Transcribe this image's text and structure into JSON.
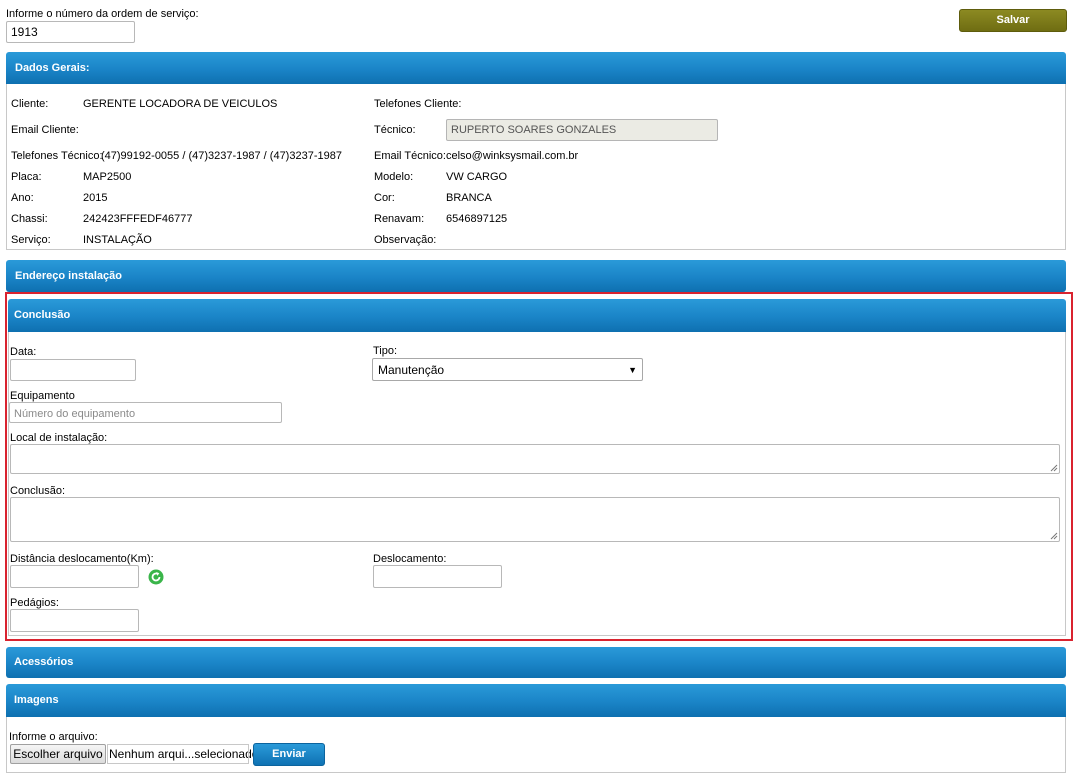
{
  "top": {
    "order_label": "Informe o número da ordem de serviço:",
    "order_value": "1913",
    "save_label": "Salvar"
  },
  "dados_gerais": {
    "title": "Dados Gerais:",
    "cliente_label": "Cliente:",
    "cliente_value": "GERENTE LOCADORA DE VEICULOS",
    "telefones_cliente_label": "Telefones Cliente:",
    "email_cliente_label": "Email Cliente:",
    "tecnico_label": "Técnico:",
    "tecnico_value": "RUPERTO SOARES GONZALES",
    "telefones_tecnico_label": "Telefones Técnico:",
    "telefones_tecnico_value": "(47)99192-0055 / (47)3237-1987 / (47)3237-1987",
    "email_tecnico_label": "Email Técnico:",
    "email_tecnico_value": "celso@winksysmail.com.br",
    "placa_label": "Placa:",
    "placa_value": "MAP2500",
    "modelo_label": "Modelo:",
    "modelo_value": "VW CARGO",
    "ano_label": "Ano:",
    "ano_value": "2015",
    "cor_label": "Cor:",
    "cor_value": "BRANCA",
    "chassi_label": "Chassi:",
    "chassi_value": "242423FFFEDF46777",
    "renavam_label": "Renavam:",
    "renavam_value": "6546897125",
    "servico_label": "Serviço:",
    "servico_value": "INSTALAÇÃO",
    "observacao_label": "Observação:"
  },
  "endereco": {
    "title": "Endereço instalação"
  },
  "conclusao": {
    "title": "Conclusão",
    "data_label": "Data:",
    "data_value": "",
    "tipo_label": "Tipo:",
    "tipo_value": "Manutenção",
    "equipamento_label": "Equipamento",
    "equipamento_placeholder": "Número do equipamento",
    "local_label": "Local de instalação:",
    "conclusao_label": "Conclusão:",
    "distancia_label": "Distância deslocamento(Km):",
    "deslocamento_label": "Deslocamento:",
    "pedagios_label": "Pedágios:"
  },
  "acessorios": {
    "title": "Acessórios"
  },
  "imagens": {
    "title": "Imagens",
    "file_label": "Informe o arquivo:",
    "choose_label": "Escolher arquivo",
    "no_file_label": "Nenhum arqui...selecionado",
    "send_label": "Enviar"
  },
  "colors": {
    "header_blue": "#1a84c7",
    "save_olive": "#7b7a18",
    "highlight_red": "#d9232f",
    "refresh_green": "#3ab54a"
  },
  "icons": {
    "refresh": "refresh-icon",
    "select_arrow": "caret-down-icon",
    "resize_grip": "resize-grip-icon"
  }
}
